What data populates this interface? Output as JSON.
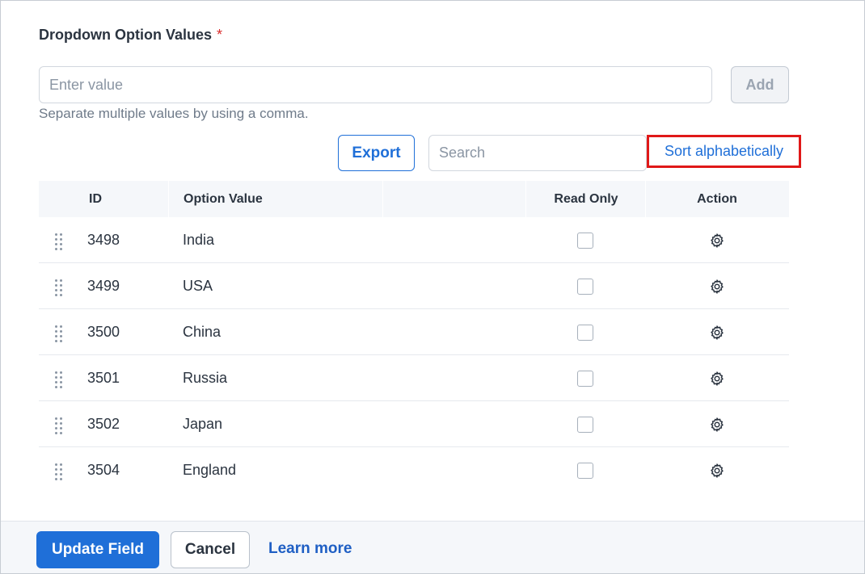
{
  "form": {
    "label": "Dropdown Option Values",
    "required_mark": "*",
    "value_input": {
      "placeholder": "Enter value",
      "value": ""
    },
    "add_label": "Add",
    "hint": "Separate multiple values by using a comma."
  },
  "toolbar": {
    "export_label": "Export",
    "search": {
      "placeholder": "Search",
      "value": ""
    },
    "sort_label": "Sort alphabetically"
  },
  "table": {
    "columns": [
      "ID",
      "Option Value",
      "Read Only",
      "Action"
    ],
    "rows": [
      {
        "id": "3498",
        "value": "India",
        "read_only": false,
        "action_icon": "gear-icon"
      },
      {
        "id": "3499",
        "value": "USA",
        "read_only": false,
        "action_icon": "gear-icon"
      },
      {
        "id": "3500",
        "value": "China",
        "read_only": false,
        "action_icon": "gear-icon"
      },
      {
        "id": "3501",
        "value": "Russia",
        "read_only": false,
        "action_icon": "gear-icon"
      },
      {
        "id": "3502",
        "value": "Japan",
        "read_only": false,
        "action_icon": "gear-icon"
      },
      {
        "id": "3504",
        "value": "England",
        "read_only": false,
        "action_icon": "gear-icon"
      }
    ]
  },
  "footer": {
    "update_label": "Update Field",
    "cancel_label": "Cancel",
    "learn_more_label": "Learn more"
  },
  "colors": {
    "primary": "#1f6fd8",
    "required": "#d92b2b",
    "highlight_border": "#e01818"
  }
}
